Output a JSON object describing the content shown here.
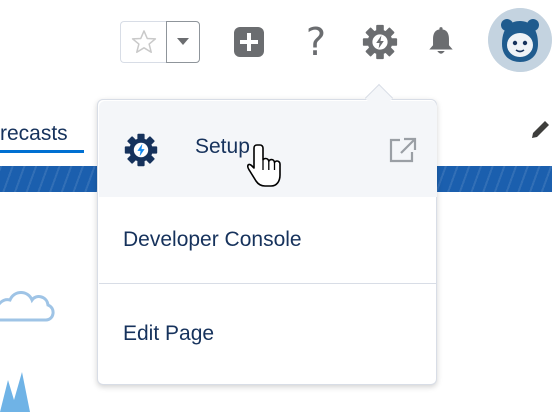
{
  "header": {
    "favorites_star_icon": "star-outline-icon",
    "favorites_dropdown_icon": "caret-down-icon",
    "global_actions_icon": "plus-square-icon",
    "help_label": "?",
    "setup_gear_icon": "gear-bolt-icon",
    "notifications_icon": "bell-icon",
    "avatar_icon": "astro-avatar"
  },
  "page": {
    "tab_text": "recasts",
    "edit_icon": "pencil-icon"
  },
  "setup_menu": {
    "items": [
      {
        "label": "Setup",
        "icon": "gear-bolt-icon",
        "trailing_icon": "external-link-icon"
      },
      {
        "label": "Developer Console"
      },
      {
        "label": "Edit Page"
      }
    ]
  },
  "colors": {
    "brand_blue": "#0070d2",
    "gear_blue": "#16325c",
    "banner_blue": "#1b5fae",
    "icon_gray": "#6b6d70",
    "menu_hover": "#f4f6f9",
    "border": "#d8dde6",
    "text": "#16325c"
  }
}
